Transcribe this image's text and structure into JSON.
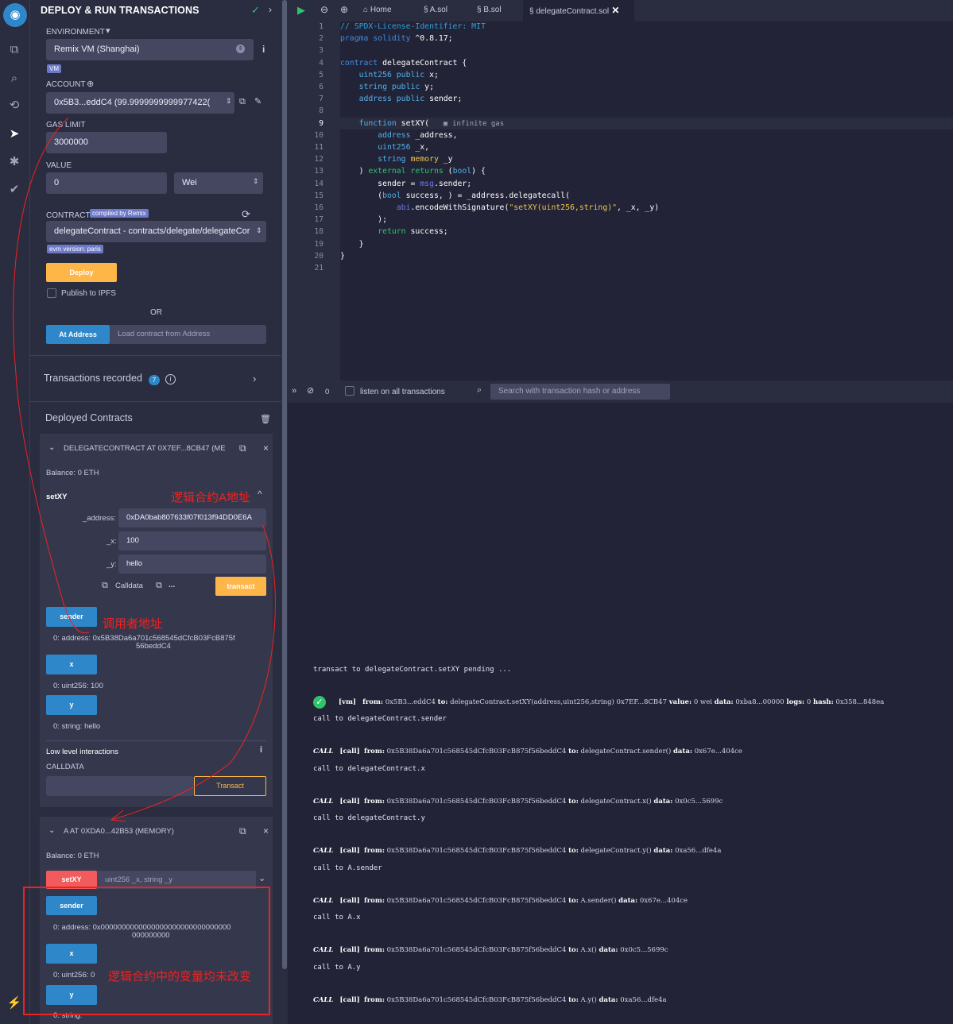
{
  "panel": {
    "title": "DEPLOY & RUN TRANSACTIONS",
    "environment_label": "ENVIRONMENT",
    "environment_value": "Remix VM (Shanghai)",
    "vm_badge": "VM",
    "account_label": "ACCOUNT",
    "account_value": "0x5B3...eddC4 (99.9999999999977422(",
    "gas_limit_label": "GAS LIMIT",
    "gas_limit_value": "3000000",
    "value_label": "VALUE",
    "value_value": "0",
    "value_unit": "Wei",
    "contract_label": "CONTRACT",
    "compiled_badge": "compiled by Remix",
    "contract_value": "delegateContract - contracts/delegate/delegateCor",
    "evm_badge": "evm version: paris",
    "deploy_button": "Deploy",
    "publish_label": "Publish to IPFS",
    "or_label": "OR",
    "at_address_button": "At Address",
    "load_placeholder": "Load contract from Address",
    "tx_recorded_label": "Transactions recorded",
    "tx_recorded_count": "7",
    "deployed_label": "Deployed Contracts"
  },
  "instance1": {
    "title": "DELEGATECONTRACT AT 0X7EF...8CB47 (ME",
    "balance": "Balance: 0 ETH",
    "fn_name": "setXY",
    "address_label": "_address:",
    "address_value": "0xDA0bab807633f07f013f94DD0E6A",
    "x_label": "_x:",
    "x_value": "100",
    "y_label": "_y:",
    "y_value": "hello",
    "calldata_label": "Calldata",
    "ellipsis": "...",
    "transact_button": "transact",
    "sender_button": "sender",
    "sender_result_1": "0: address: 0x5B38Da6a701c568545dCfcB03FcB875f",
    "sender_result_2": "56beddC4",
    "x_button": "x",
    "x_result": "0: uint256: 100",
    "y_button": "y",
    "y_result": "0: string: hello",
    "low_level_label": "Low level interactions",
    "calldata_field_label": "CALLDATA",
    "low_transact_button": "Transact"
  },
  "instance2": {
    "title": "A AT 0XDA0...42B53 (MEMORY)",
    "balance": "Balance: 0 ETH",
    "setxy_button": "setXY",
    "setxy_placeholder": "uint256 _x, string _y",
    "sender_button": "sender",
    "sender_result_1": "0: address: 0x0000000000000000000000000000000",
    "sender_result_2": "000000000",
    "x_button": "x",
    "x_result": "0: uint256: 0",
    "y_button": "y",
    "y_result": "0: string:"
  },
  "annotations": {
    "note_a_address": "逻辑合约A地址",
    "note_caller": "调用者地址",
    "note_unchanged": "逻辑合约中的变量均未改变"
  },
  "tabs": [
    "Home",
    "A.sol",
    "B.sol",
    "delegateContract.sol"
  ],
  "editor": {
    "line_numbers": [
      "1",
      "2",
      "3",
      "4",
      "5",
      "6",
      "7",
      "8",
      "9",
      "10",
      "11",
      "12",
      "13",
      "14",
      "15",
      "16",
      "17",
      "18",
      "19",
      "20",
      "21"
    ],
    "gas_hint": "infinite gas"
  },
  "terminal": {
    "count": "0",
    "listen_label": "listen on all transactions",
    "search_placeholder": "Search with transaction hash or address",
    "pending": "transact to delegateContract.setXY pending ...",
    "vm_line": {
      "tag": "[vm]",
      "from_k": "from:",
      "from_v": "0x5B3...eddC4",
      "to_k": "to:",
      "to_v": "delegateContract.setXY(address,uint256,string) 0x7EF...8CB47",
      "value_k": "value:",
      "value_v": "0 wei",
      "data_k": "data:",
      "data_v": "0xba8...00000",
      "logs_k": "logs:",
      "logs_v": "0",
      "hash_k": "hash:",
      "hash_v": "0x358...848ea"
    },
    "calls": [
      {
        "title": "call to delegateContract.sender",
        "to": "delegateContract.sender()",
        "data": "0x67e...404ce"
      },
      {
        "title": "call to delegateContract.x",
        "to": "delegateContract.x()",
        "data": "0x0c5...5699c"
      },
      {
        "title": "call to delegateContract.y",
        "to": "delegateContract.y()",
        "data": "0xa56...dfe4a"
      },
      {
        "title": "call to A.sender",
        "to": "A.sender()",
        "data": "0x67e...404ce"
      },
      {
        "title": "call to A.x",
        "to": "A.x()",
        "data": "0x0c5...5699c"
      },
      {
        "title": "call to A.y",
        "to": "A.y()",
        "data": "0xa56...dfe4a"
      }
    ],
    "call_tag": "CALL",
    "call_sub": "[call]",
    "from_k": "from:",
    "call_from": "0x5B38Da6a701c568545dCfcB03FcB875f56beddC4",
    "to_k": "to:",
    "data_k": "data:"
  }
}
